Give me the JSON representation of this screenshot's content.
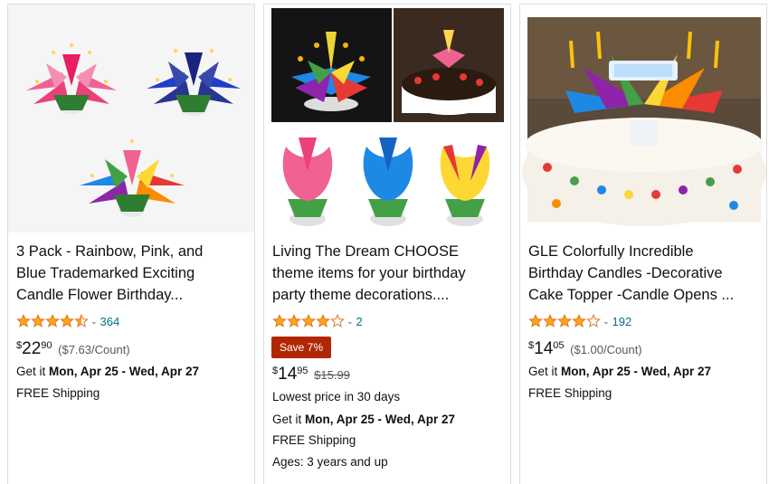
{
  "products": [
    {
      "title_lines": [
        "3 Pack - Rainbow, Pink, and",
        "Blue Trademarked Exciting",
        "Candle Flower Birthday..."
      ],
      "rating": 4.5,
      "review_count": "364",
      "price_symbol": "$",
      "price_whole": "22",
      "price_frac": "90",
      "unit_price": "($7.63/Count)",
      "delivery_prefix": "Get it ",
      "delivery_dates": "Mon, Apr 25 - Wed, Apr 27",
      "shipping": "FREE Shipping"
    },
    {
      "title_lines": [
        "Living The Dream CHOOSE",
        "theme items for your birthday",
        "party theme decorations...."
      ],
      "rating": 4.0,
      "review_count": "2",
      "badge": "Save 7%",
      "price_symbol": "$",
      "price_whole": "14",
      "price_frac": "95",
      "list_price": "$15.99",
      "lowest_price": "Lowest price in 30 days",
      "delivery_prefix": "Get it ",
      "delivery_dates": "Mon, Apr 25 - Wed, Apr 27",
      "shipping": "FREE Shipping",
      "ages": "Ages: 3 years and up"
    },
    {
      "title_lines": [
        "GLE Colorfully Incredible",
        "Birthday Candles -Decorative",
        "Cake Topper -Candle Opens ..."
      ],
      "rating": 4.0,
      "review_count": "192",
      "price_symbol": "$",
      "price_whole": "14",
      "price_frac": "05",
      "unit_price": "($1.00/Count)",
      "delivery_prefix": "Get it ",
      "delivery_dates": "Mon, Apr 25 - Wed, Apr 27",
      "shipping": "FREE Shipping"
    }
  ],
  "colors": {
    "star": "#ffa41c",
    "link": "#007185",
    "badge": "#b12704",
    "secondary_text": "#565959"
  }
}
